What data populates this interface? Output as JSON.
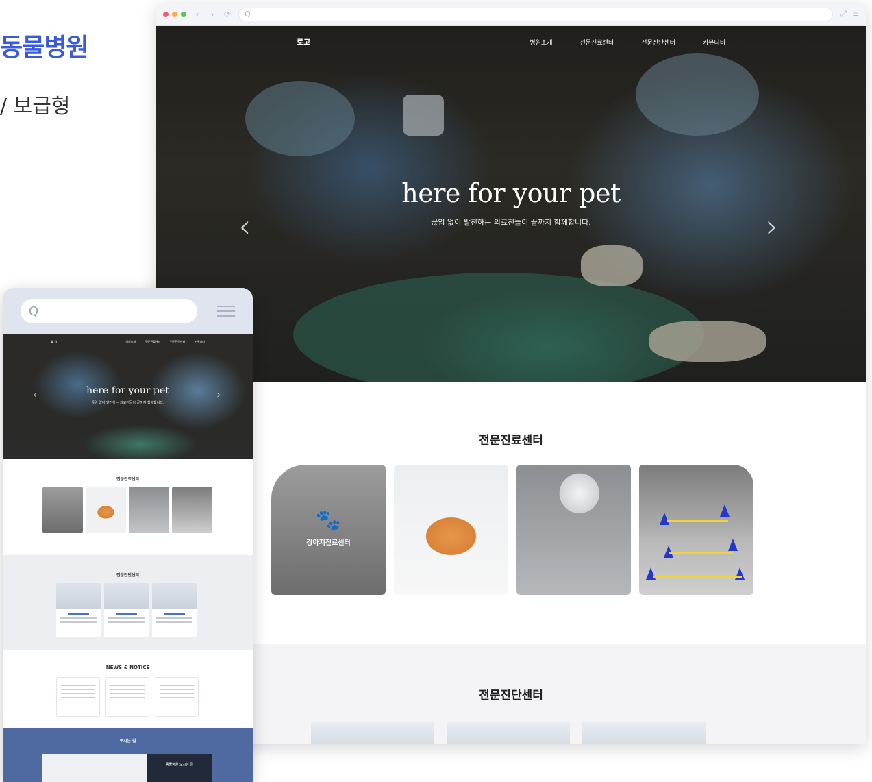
{
  "template": {
    "title": "동물병원",
    "subtitle": "/ 보급형"
  },
  "desktop": {
    "browser": {
      "url_text": "Q",
      "nav_back": "‹",
      "nav_forward": "›"
    },
    "nav": {
      "logo": "로고",
      "menu": [
        "병원소개",
        "전문진료센터",
        "전문진단센터",
        "커뮤니티"
      ]
    },
    "hero": {
      "heading": "here for your pet",
      "subtext": "끊임 없이 발전하는 의료진들이 끝까지 함께합니다.",
      "prev_arrow": "‹",
      "next_arrow": "›"
    },
    "specialty": {
      "title": "전문진료센터",
      "card1_label": "강아지진료센터",
      "card1_icon": "paw-icon"
    },
    "diagnosis": {
      "title": "전문진단센터"
    }
  },
  "mobile": {
    "search_icon": "Q",
    "nav": {
      "logo": "로고",
      "menu": [
        "병원소개",
        "전문진료센터",
        "전문진단센터",
        "커뮤니티"
      ]
    },
    "hero": {
      "heading": "here for your pet",
      "subtext": "끊임 없이 발전하는 의료진들이 끝까지 함께합니다.",
      "prev_arrow": "‹",
      "next_arrow": "›"
    },
    "specialty_title": "전문진료센터",
    "diagnosis_title": "전문진단센터",
    "news_title": "NEWS & NOTICE",
    "directions_title": "오시는 길",
    "directions_box": "동물병원 오시는 길"
  },
  "colors": {
    "accent": "#3a5bd9",
    "mobile_footer": "#4e6aa1",
    "dot_red": "#f35c6e",
    "dot_yellow": "#f5b042",
    "dot_green": "#5cc05c"
  }
}
